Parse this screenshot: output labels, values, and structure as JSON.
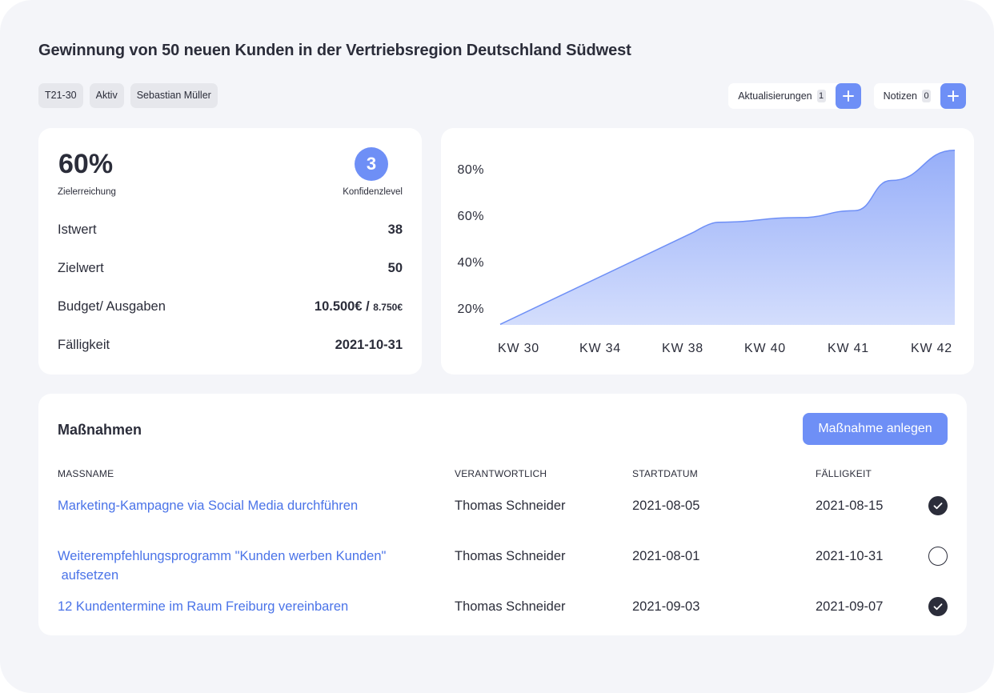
{
  "title": "Gewinnung von 50 neuen Kunden in der Vertriebsregion Deutschland Südwest",
  "chips": [
    "T21-30",
    "Aktiv",
    "Sebastian Müller"
  ],
  "actions": {
    "updates": {
      "label": "Aktualisierungen",
      "count": "1"
    },
    "notes": {
      "label": "Notizen",
      "count": "0"
    }
  },
  "stats": {
    "achievement": "60%",
    "achievement_label": "Zielerreichung",
    "confidence": "3",
    "confidence_label": "Konfidenzlevel",
    "rows": [
      {
        "label": "Istwert",
        "value": "38"
      },
      {
        "label": "Zielwert",
        "value": "50"
      },
      {
        "label": "Budget/ Ausgaben",
        "value": "10.500€ /",
        "value_small": "8.750€"
      },
      {
        "label": "Fälligkeit",
        "value": "2021-10-31"
      }
    ]
  },
  "chart_data": {
    "type": "area",
    "categories": [
      "KW 30",
      "KW 34",
      "KW 38",
      "KW 40",
      "KW 41",
      "KW 42"
    ],
    "y_ticks": [
      "20%",
      "40%",
      "60%",
      "80%"
    ],
    "ylim": [
      20,
      80
    ],
    "points": [
      {
        "x": 0.0,
        "y": 13
      },
      {
        "x": 2.4,
        "y": 57
      },
      {
        "x": 3.3,
        "y": 59
      },
      {
        "x": 3.9,
        "y": 62
      },
      {
        "x": 4.3,
        "y": 75
      },
      {
        "x": 5.0,
        "y": 88
      }
    ],
    "color": "#6e8ff6"
  },
  "measures": {
    "title": "Maßnahmen",
    "add_button": "Maßnahme anlegen",
    "headers": [
      "MASSNAME",
      "VERANTWORTLICH",
      "STARTDATUM",
      "FÄLLIGKEIT"
    ],
    "rows": [
      {
        "name": "Marketing-Kampagne via Social Media durchführen",
        "owner": "Thomas Schneider",
        "start": "2021-08-05",
        "due": "2021-08-15",
        "done": true
      },
      {
        "name": "Weiterempfehlungsprogramm \"Kunden werben Kunden\"",
        "name2": " aufsetzen",
        "owner": "Thomas Schneider",
        "start": "2021-08-01",
        "due": "2021-10-31",
        "done": false
      },
      {
        "name": "12 Kundentermine im Raum Freiburg vereinbaren",
        "owner": "Thomas Schneider",
        "start": "2021-09-03",
        "due": "2021-09-07",
        "done": true
      }
    ]
  },
  "colors": {
    "accent": "#6e8ff6",
    "link": "#4a73e8",
    "background": "#f4f5f9",
    "text": "#2b2d3a"
  },
  "icons": {
    "add": "plus-icon",
    "done": "check-circle-icon",
    "open": "empty-circle-icon"
  }
}
